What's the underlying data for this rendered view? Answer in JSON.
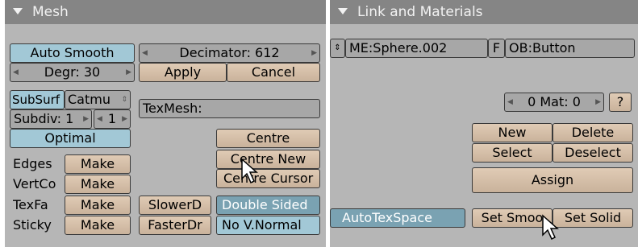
{
  "mesh": {
    "title": "Mesh",
    "auto_smooth": "Auto Smooth",
    "degr": "Degr: 30",
    "decimator": "Decimator: 612",
    "apply": "Apply",
    "cancel": "Cancel",
    "subsurf": "SubSurf",
    "catmull": "Catmu",
    "subdiv": "Subdiv: 1",
    "subdiv_render": "1",
    "optimal": "Optimal",
    "texmesh": "TexMesh:",
    "centre": "Centre",
    "centre_new": "Centre New",
    "centre_cursor": "Centre Cursor",
    "edges": "Edges",
    "vertcol": "VertCo",
    "texface": "TexFa",
    "sticky": "Sticky",
    "make": "Make",
    "slower_draw": "SlowerD",
    "faster_draw": "FasterDr",
    "double_sided": "Double Sided",
    "no_v_normal": "No V.Normal"
  },
  "link": {
    "title": "Link and Materials",
    "me_name": "ME:Sphere.002",
    "f_label": "F",
    "ob_name": "OB:Button",
    "mat": "0 Mat: 0",
    "question": "?",
    "new": "New",
    "delete": "Delete",
    "select": "Select",
    "deselect": "Deselect",
    "assign": "Assign",
    "autotexspace": "AutoTexSpace",
    "set_smooth": "Set Smoo",
    "set_solid": "Set Solid"
  },
  "colors": {
    "panel_bg": "#b6b6b6",
    "header_bg": "#858585",
    "button": "#d6c0a9",
    "toggle": "#a2c8d6",
    "toggle_on": "#7aa2b2"
  }
}
